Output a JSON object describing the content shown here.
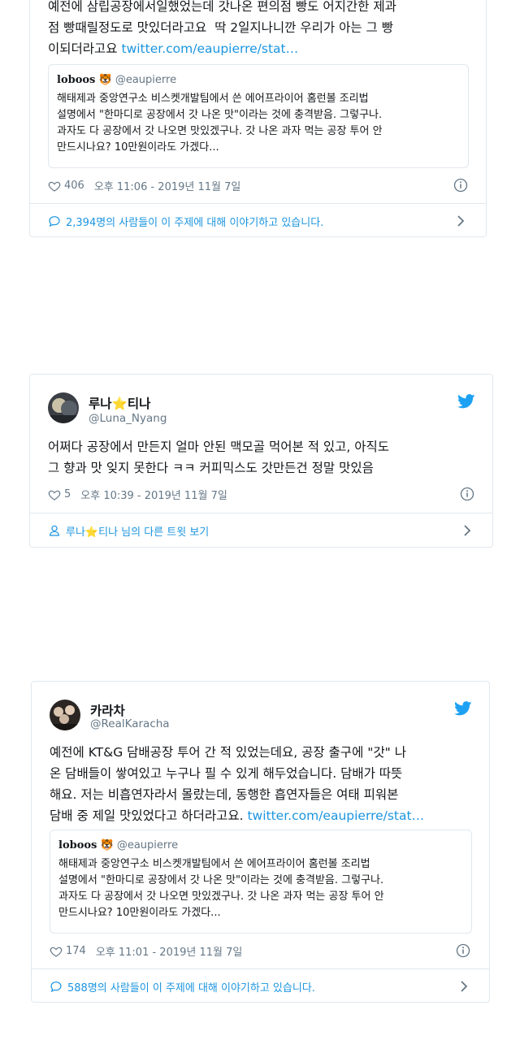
{
  "tweet1": {
    "text_lines": [
      "예전에 삼립공장에서일했었는데 갓나온 편의점 빵도 어지간한 제과",
      "점 빵때릴정도로 맛있더라고요  딱 2일지나니깐 우리가 아는 그 빵",
      "이되더라고요 "
    ],
    "link": "twitter.com/eaupierre/stat…",
    "quote": {
      "name": "loboos",
      "emoji": "🐯",
      "handle": "@eaupierre",
      "text": "해태제과 중앙연구소 비스켓개발팀에서 쓴 에어프라이어 홈런볼 조리법\n설명에서 \"한마디로 공장에서 갓 나온 맛\"이라는 것에 충격받음. 그렇구나.\n과자도 다 공장에서 갓 나오면 맛있겠구나. 갓 나온 과자 먹는 공장 투어 안\n만드시나요? 10만원이라도 가겠다..."
    },
    "likes": "406",
    "timestamp": "오후 11:06 - 2019년 11월 7일",
    "footer": "2,394명의 사람들이 이 주제에 대해 이야기하고 있습니다."
  },
  "tweet2": {
    "name_left": "루나",
    "name_star": "⭐",
    "name_right": "티나",
    "handle": "@Luna_Nyang",
    "text": "어쩌다 공장에서 만든지 얼마 안된 맥모골 먹어본 적 있고, 아직도\n그 향과 맛 잊지 못한다 ㅋㅋ 커피믹스도 갓만든건 정말 맛있음",
    "likes": "5",
    "timestamp": "오후 10:39 - 2019년 11월 7일",
    "footer": "루나⭐티나 님의 다른 트윗 보기"
  },
  "tweet3": {
    "name": "카라차",
    "handle": "@RealKaracha",
    "text_lines": [
      "예전에 KT&G 담배공장 투어 간 적 있었는데요, 공장 출구에 \"갓\" 나",
      "온 담배들이 쌓여있고 누구나 필 수 있게 해두었습니다. 담배가 따뜻",
      "해요. 저는 비흡연자라서 몰랐는데, 동행한 흡연자들은 여태 피워본",
      "담배 중 제일 맛있었다고 하더라고요. "
    ],
    "link": "twitter.com/eaupierre/stat…",
    "quote": {
      "name": "loboos",
      "emoji": "🐯",
      "handle": "@eaupierre",
      "text": "해태제과 중앙연구소 비스켓개발팀에서 쓴 에어프라이어 홈런볼 조리법\n설명에서 \"한마디로 공장에서 갓 나온 맛\"이라는 것에 충격받음. 그렇구나.\n과자도 다 공장에서 갓 나오면 맛있겠구나. 갓 나온 과자 먹는 공장 투어 안\n만드시나요? 10만원이라도 가겠다..."
    },
    "likes": "174",
    "timestamp": "오후 11:01 - 2019년 11월 7일",
    "footer": "588명의 사람들이 이 주제에 대해 이야기하고 있습니다."
  },
  "colors": {
    "link": "#1b95e0",
    "muted": "#657786",
    "border": "#e1e8ed",
    "star": "#f5a623"
  },
  "icons": [
    "heart-icon",
    "info-icon",
    "speech-bubble-icon",
    "person-icon",
    "chevron-right-icon",
    "twitter-bird-icon"
  ]
}
